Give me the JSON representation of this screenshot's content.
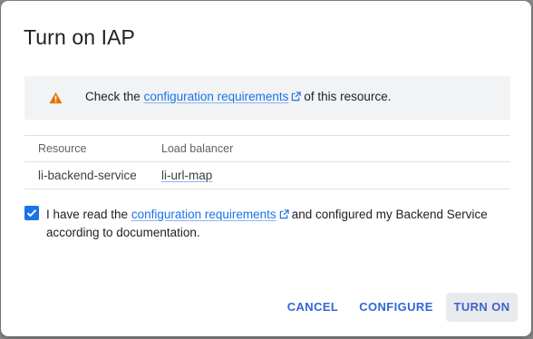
{
  "dialog": {
    "title": "Turn on IAP"
  },
  "notice": {
    "icon": "warning-icon",
    "prefix": "Check the",
    "link": "configuration requirements",
    "suffix": "of this resource.",
    "icon_color": "#e37400"
  },
  "table": {
    "headers": [
      "Resource",
      "Load balancer"
    ],
    "rows": [
      {
        "resource": "li-backend-service",
        "load_balancer": "li-url-map"
      }
    ]
  },
  "confirmation": {
    "checked": true,
    "prefix": "I have read the",
    "link": "configuration requirements",
    "line1_suffix": "and configured my Backend Service",
    "line2": "according to documentation."
  },
  "buttons": {
    "cancel": "CANCEL",
    "configure": "CONFIGURE",
    "turn_on": "TURN ON"
  },
  "colors": {
    "accent": "#1a73e8",
    "notice_bg": "#f1f3f4"
  }
}
